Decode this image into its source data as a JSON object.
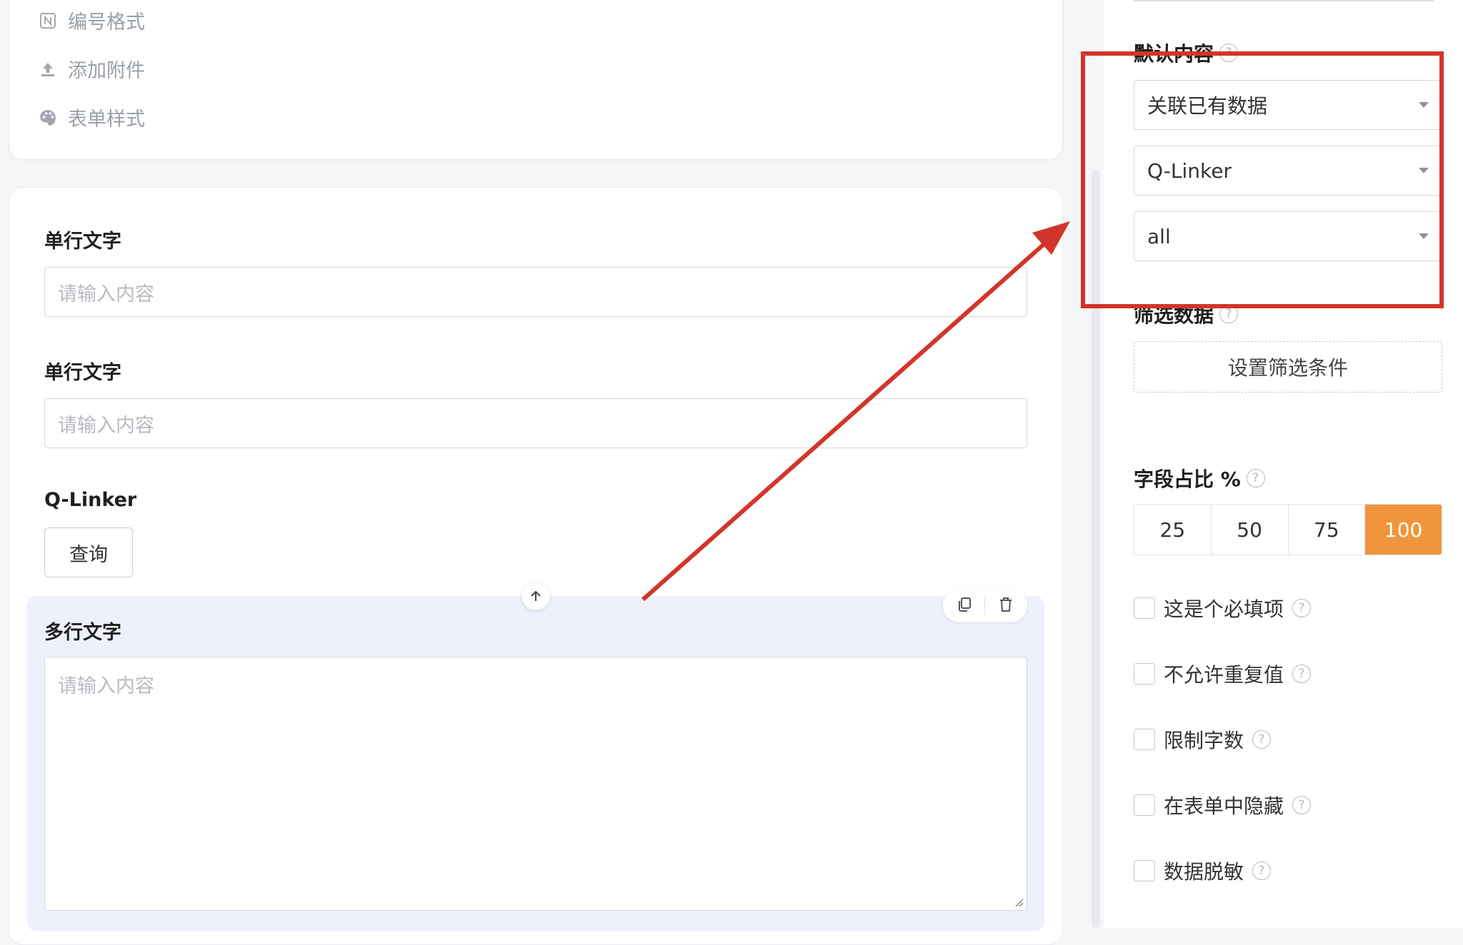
{
  "menu": {
    "items": [
      {
        "label": "编号格式",
        "icon": "number-format-icon"
      },
      {
        "label": "添加附件",
        "icon": "upload-icon"
      },
      {
        "label": "表单样式",
        "icon": "palette-icon"
      }
    ]
  },
  "form": {
    "field1": {
      "label": "单行文字",
      "placeholder": "请输入内容"
    },
    "field2": {
      "label": "单行文字",
      "placeholder": "请输入内容"
    },
    "field3": {
      "label": "Q-Linker",
      "button": "查询"
    },
    "field4": {
      "label": "多行文字",
      "placeholder": "请输入内容"
    }
  },
  "panel": {
    "default_content": {
      "label": "默认内容",
      "select1": "关联已有数据",
      "select2": "Q-Linker",
      "select3": "all"
    },
    "filter": {
      "label": "筛选数据",
      "button": "设置筛选条件"
    },
    "ratio": {
      "label": "字段占比 %",
      "options": [
        "25",
        "50",
        "75",
        "100"
      ],
      "selected": "100"
    },
    "checks": [
      "这是个必填项",
      "不允许重复值",
      "限制字数",
      "在表单中隐藏",
      "数据脱敏"
    ]
  },
  "colors": {
    "accent": "#f0953c",
    "annotation": "#d2352a",
    "selected_block": "#eef1fb"
  }
}
